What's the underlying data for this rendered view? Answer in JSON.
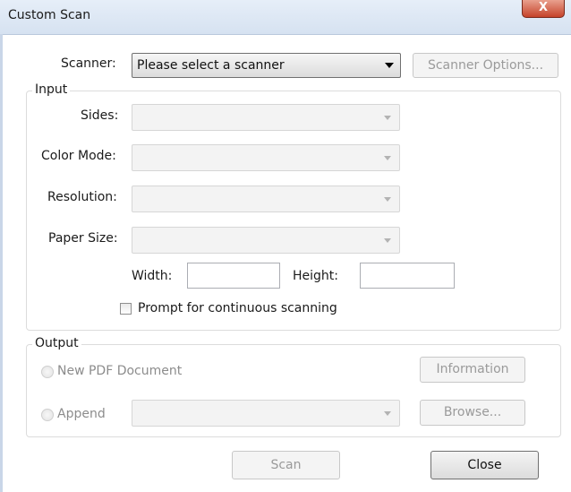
{
  "window": {
    "title": "Custom Scan",
    "close_glyph": "X"
  },
  "scanner": {
    "label": "Scanner:",
    "selected": "Please select a scanner",
    "options_button": "Scanner Options..."
  },
  "input_group": {
    "legend": "Input",
    "sides_label": "Sides:",
    "color_mode_label": "Color Mode:",
    "resolution_label": "Resolution:",
    "paper_size_label": "Paper Size:",
    "width_label": "Width:",
    "height_label": "Height:",
    "width_value": "",
    "height_value": "",
    "prompt_checkbox_label": "Prompt for continuous scanning"
  },
  "output_group": {
    "legend": "Output",
    "new_pdf_label": "New PDF Document",
    "append_label": "Append",
    "information_button": "Information",
    "browse_button": "Browse..."
  },
  "footer": {
    "scan_button": "Scan",
    "close_button": "Close"
  }
}
